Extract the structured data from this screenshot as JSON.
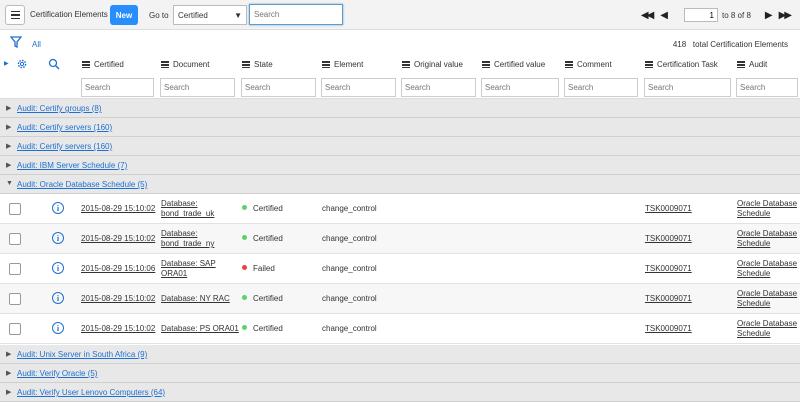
{
  "toolbar": {
    "title": "Certification Elements",
    "new_label": "New",
    "goto_label": "Go to",
    "goto_selected": "Certified",
    "search_placeholder": "Search",
    "pager": {
      "current_page": "1",
      "range_text": "to 8 of 8",
      "first_icon": "first-page-icon",
      "prev_icon": "prev-page-icon",
      "next_icon": "next-page-icon",
      "last_icon": "last-page-icon"
    }
  },
  "filter": {
    "all_label": "All",
    "total_count": "418",
    "total_text": "total Certification Elements"
  },
  "columns": [
    "Certified",
    "Document",
    "State",
    "Element",
    "Original value",
    "Certified value",
    "Comment",
    "Certification Task",
    "Audit"
  ],
  "column_search_placeholder": "Search",
  "groups": [
    {
      "label": "Audit: Certify groups (8)",
      "expanded": false
    },
    {
      "label": "Audit: Certify servers (160)",
      "expanded": false
    },
    {
      "label": "Audit: Certify servers (160)",
      "expanded": false
    },
    {
      "label": "Audit: IBM Server Schedule (7)",
      "expanded": false
    },
    {
      "label": "Audit: Oracle Database Schedule (5)",
      "expanded": true
    },
    {
      "label": "Audit: Unix Server in South Africa (9)",
      "expanded": false
    },
    {
      "label": "Audit: Verify Oracle (5)",
      "expanded": false
    },
    {
      "label": "Audit: Verify User Lenovo Computers (64)",
      "expanded": false
    }
  ],
  "rows": [
    {
      "certified": "2015-08-29 15:10:02",
      "document_1": "Database:",
      "document_2": "bond_trade_uk",
      "state": "Certified",
      "element": "change_control",
      "task": "TSK0009071",
      "audit_1": "Oracle Database",
      "audit_2": "Schedule"
    },
    {
      "certified": "2015-08-29 15:10:02",
      "document_1": "Database:",
      "document_2": "bond_trade_ny",
      "state": "Certified",
      "element": "change_control",
      "task": "TSK0009071",
      "audit_1": "Oracle Database",
      "audit_2": "Schedule"
    },
    {
      "certified": "2015-08-29 15:10:06",
      "document_1": "Database: SAP",
      "document_2": "ORA01",
      "state": "Failed",
      "element": "change_control",
      "task": "TSK0009071",
      "audit_1": "Oracle Database",
      "audit_2": "Schedule"
    },
    {
      "certified": "2015-08-29 15:10:02",
      "document_1": "Database: NY RAC",
      "document_2": "",
      "state": "Certified",
      "element": "change_control",
      "task": "TSK0009071",
      "audit_1": "Oracle Database",
      "audit_2": "Schedule"
    },
    {
      "certified": "2015-08-29 15:10:02",
      "document_1": "Database: PS ORA01",
      "document_2": "",
      "state": "Certified",
      "element": "change_control",
      "task": "TSK0009071",
      "audit_1": "Oracle Database",
      "audit_2": "Schedule"
    }
  ],
  "colors": {
    "accent": "#278efc",
    "link": "#1f6fd0",
    "certified": "#5bd36a",
    "failed": "#e8453c"
  }
}
